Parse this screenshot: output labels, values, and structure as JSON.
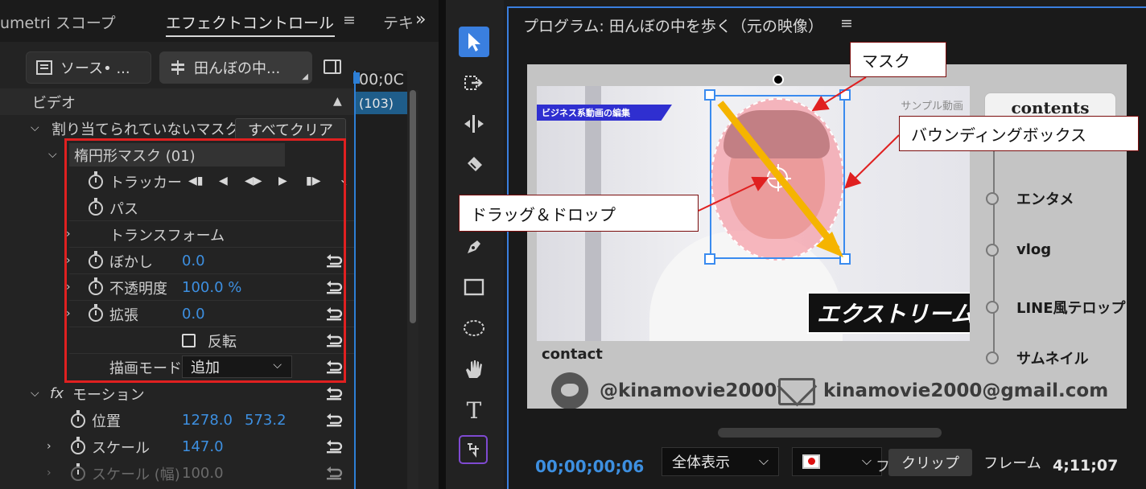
{
  "left_panel": {
    "tabs": {
      "lumetri": "umetri スコープ",
      "effect": "エフェクトコントロール",
      "effect_menu": "≡",
      "text": "テキ",
      "overflow": "»"
    },
    "source_button": "ソース• ...",
    "clip_button": "田んぼの中...",
    "timeline": {
      "time": "00;0C",
      "clip_label": "(103)"
    },
    "rows": {
      "video": "ビデオ",
      "unassigned_masks": "割り当てられていないマスク",
      "clear_all": "すべてクリア",
      "ellipse_mask": "楕円形マスク (01)",
      "tracker": "トラッカー",
      "path": "パス",
      "transform": "トランスフォーム",
      "feather": {
        "label": "ぼかし",
        "value": "0.0"
      },
      "opacity": {
        "label": "不透明度",
        "value": "100.0 %"
      },
      "expand": {
        "label": "拡張",
        "value": "0.0"
      },
      "invert": "反転",
      "blend_mode": {
        "label": "描画モード",
        "value": "追加"
      },
      "motion": "モーション",
      "fx": "fx",
      "position": {
        "label": "位置",
        "x": "1278.0",
        "y": "573.2"
      },
      "scale": {
        "label": "スケール",
        "value": "147.0"
      },
      "scale_width": {
        "label": "スケール (幅)",
        "value": "100.0"
      }
    }
  },
  "program": {
    "title": "プログラム: 田んぼの中を歩く（元の映像）",
    "menu": "≡",
    "video": {
      "banner": "ビジネス系動画の編集",
      "sample": "サンプル動画",
      "extreme": "エクストリーム",
      "contents": "contents",
      "menu_items": [
        "エンタメ",
        "vlog",
        "LINE風テロップ",
        "サムネイル"
      ],
      "contact": "contact",
      "twitter": "@kinamovie2000",
      "email": "kinamovie2000@gmail.com"
    },
    "callouts": {
      "mask": "マスク",
      "bbox": "バウンディングボックス",
      "drag": "ドラッグ＆ドロップ"
    },
    "bottom": {
      "timecode": "00;00;00;06",
      "zoom": "全体表示",
      "mode_frag": "フ",
      "clip": "クリップ",
      "frame": "フレーム",
      "duration": "4;11;07"
    }
  },
  "colors": {
    "accent": "#3a7fdf",
    "value_blue": "#3d8fe0",
    "highlight_red": "#e02020",
    "arrow": "#f5b400",
    "mask_fill": "#f6a0aa"
  },
  "icons": [
    "selection-tool-icon",
    "track-select-forward-icon",
    "ripple-edit-icon",
    "razor-icon",
    "pen-icon",
    "rectangle-icon",
    "ellipse-icon",
    "hand-icon",
    "type-icon",
    "essential-graphics-icon"
  ]
}
